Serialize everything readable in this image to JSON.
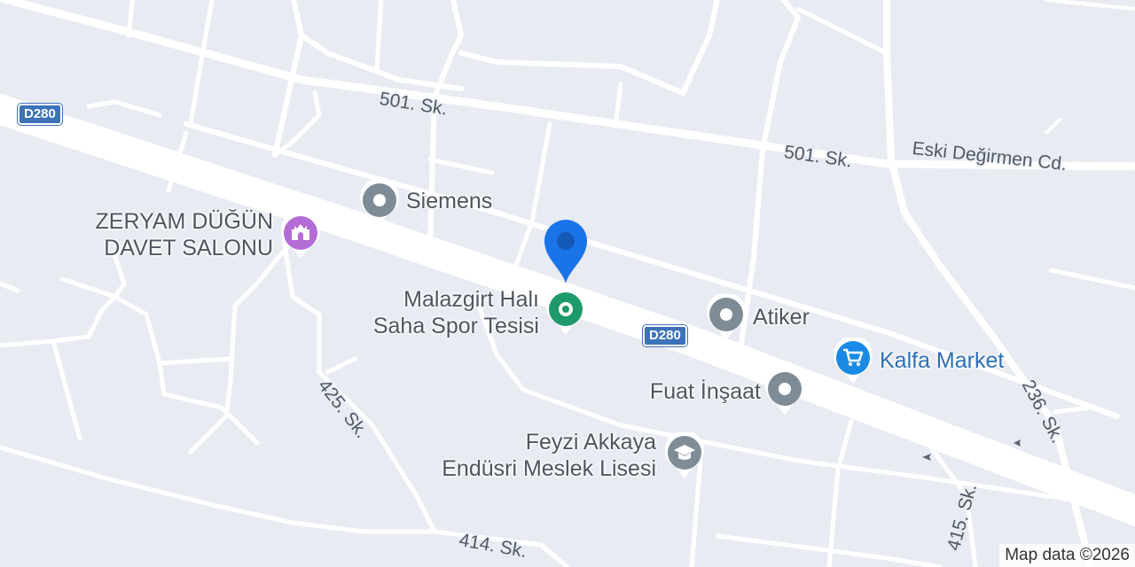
{
  "colors": {
    "background": "#e8ebf2",
    "road": "#ffffff",
    "street_label": "#4f5967",
    "shield": "#3d72b8",
    "poi_generic": "#7e8c97",
    "poi_wedding": "#b36bd6",
    "poi_sports": "#1e9a6a",
    "poi_shopping": "#1a8ae6",
    "poi_school": "#7e8c97",
    "marker": "#1a73e8"
  },
  "street_labels": {
    "s501_a": "501. Sk.",
    "s501_b": "501. Sk.",
    "eski_degirmen": "Eski Değirmen Cd.",
    "s425": "425. Sk.",
    "s414": "414. Sk.",
    "s415": "415. Sk.",
    "s236": "236. Sk."
  },
  "route_shields": {
    "d280_left": "D280",
    "d280_center": "D280"
  },
  "pois": {
    "siemens": {
      "name": "Siemens",
      "icon": "pin-generic-icon"
    },
    "zeryam": {
      "line1": "ZERYAM DÜĞÜN",
      "line2": "DAVET SALONU",
      "icon": "wedding-venue-icon"
    },
    "malazgirt": {
      "line1": "Malazgirt Halı",
      "line2": "Saha Spor Tesisi",
      "icon": "sports-venue-icon"
    },
    "atiker": {
      "name": "Atiker",
      "icon": "pin-generic-icon"
    },
    "kalfa": {
      "name": "Kalfa Market",
      "icon": "shopping-cart-icon"
    },
    "fuat": {
      "name": "Fuat İnşaat",
      "icon": "pin-generic-icon"
    },
    "feyzi": {
      "line1": "Feyzi Akkaya",
      "line2": "Endüsri Meslek Lisesi",
      "icon": "graduation-cap-icon"
    }
  },
  "selected_marker": {
    "icon": "location-marker-icon"
  },
  "attribution": "Map data ©2026"
}
